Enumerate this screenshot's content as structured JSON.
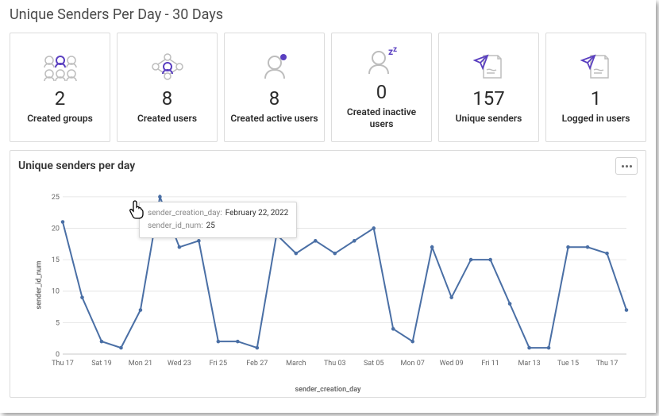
{
  "page_title": "Unique Senders Per Day - 30 Days",
  "cards": [
    {
      "value": "2",
      "label": "Created groups",
      "icon": "groups"
    },
    {
      "value": "8",
      "label": "Created users",
      "icon": "users-net"
    },
    {
      "value": "8",
      "label": "Created active users",
      "icon": "user-active"
    },
    {
      "value": "0",
      "label": "Created inactive users",
      "icon": "user-inactive"
    },
    {
      "value": "157",
      "label": "Unique senders",
      "icon": "send-doc"
    },
    {
      "value": "1",
      "label": "Logged in users",
      "icon": "send-doc"
    }
  ],
  "chart": {
    "title": "Unique senders per day",
    "ylabel": "sender_id_num",
    "xlabel": "sender_creation_day"
  },
  "tooltip": {
    "date_key": "sender_creation_day:",
    "date_val": "February 22, 2022",
    "num_key": "sender_id_num:",
    "num_val": "25"
  },
  "chart_data": {
    "type": "line",
    "title": "Unique senders per day",
    "xlabel": "sender_creation_day",
    "ylabel": "sender_id_num",
    "ylim": [
      0,
      27
    ],
    "x_ticks": [
      "Thu 17",
      "Sat 19",
      "Mon 21",
      "Wed 23",
      "Fri 25",
      "Feb 27",
      "March",
      "Thu 03",
      "Sat 05",
      "Mon 07",
      "Wed 09",
      "Fri 11",
      "Mar 13",
      "Tue 15",
      "Thu 17"
    ],
    "y_ticks": [
      0,
      5,
      10,
      15,
      20,
      25
    ],
    "categories": [
      "Feb 17",
      "Feb 18",
      "Feb 19",
      "Feb 20",
      "Feb 21",
      "Feb 22",
      "Feb 23",
      "Feb 24",
      "Feb 25",
      "Feb 26",
      "Feb 27",
      "Feb 28",
      "Mar 01",
      "Mar 02",
      "Mar 03",
      "Mar 04",
      "Mar 05",
      "Mar 06",
      "Mar 07",
      "Mar 08",
      "Mar 09",
      "Mar 10",
      "Mar 11",
      "Mar 12",
      "Mar 13",
      "Mar 14",
      "Mar 15",
      "Mar 16",
      "Mar 17",
      "Mar 18"
    ],
    "values": [
      21,
      9,
      2,
      1,
      7,
      25,
      17,
      18,
      2,
      2,
      1,
      19,
      16,
      18,
      16,
      18,
      20,
      4,
      2,
      17,
      9,
      15,
      15,
      8,
      1,
      1,
      17,
      17,
      16,
      7
    ]
  }
}
